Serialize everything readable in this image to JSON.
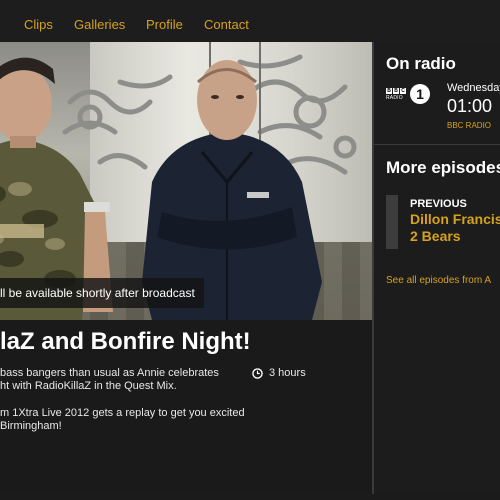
{
  "nav": {
    "items": [
      {
        "label": "Clips"
      },
      {
        "label": "Galleries"
      },
      {
        "label": "Profile"
      },
      {
        "label": "Contact"
      }
    ],
    "accent_color": "#d6a21e"
  },
  "episode": {
    "availability": "ll be available shortly after broadcast",
    "title": "laZ and Bonfire Night!",
    "description_lines": [
      "bass bangers than usual as Annie celebrates",
      "ht with RadioKillaZ in the Quest Mix."
    ],
    "description_lines_2": [
      "m 1Xtra Live 2012 gets a replay to get you excited",
      "Birmingham!"
    ],
    "duration": "3 hours",
    "clock_icon": "clock-icon"
  },
  "sidebar": {
    "on_radio": {
      "heading": "On radio",
      "bbc_letters": [
        "B",
        "B",
        "C"
      ],
      "radio_word": "RADIO",
      "station_number": "1",
      "day": "Wednesday",
      "time": "01:00",
      "station": "BBC RADIO"
    },
    "more_episodes": {
      "heading": "More episodes",
      "previous_label": "PREVIOUS",
      "previous_title_line1": "Dillon Francis",
      "previous_title_line2": "2 Bears",
      "see_all": "See all episodes from A"
    }
  }
}
